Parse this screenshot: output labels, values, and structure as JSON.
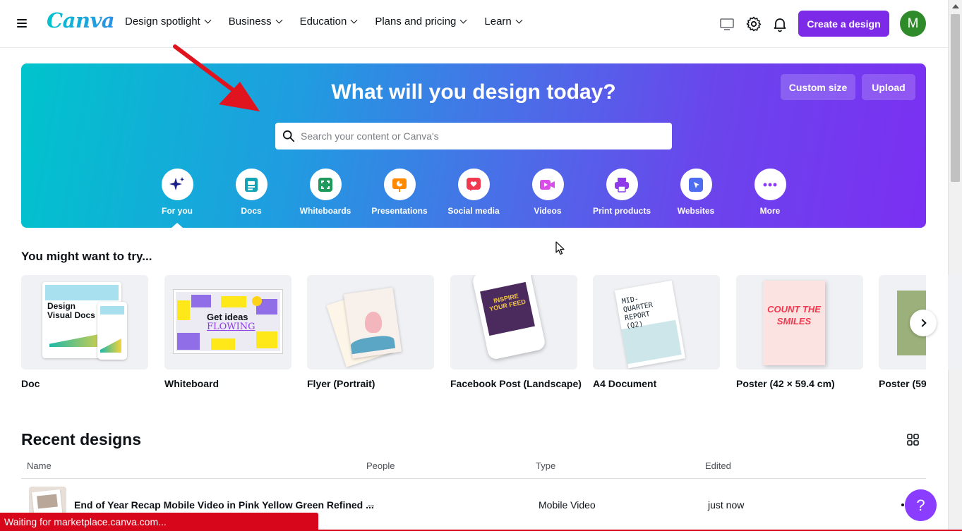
{
  "header": {
    "logo": "Canva",
    "nav": [
      {
        "label": "Design spotlight"
      },
      {
        "label": "Business"
      },
      {
        "label": "Education"
      },
      {
        "label": "Plans and pricing"
      },
      {
        "label": "Learn"
      }
    ],
    "create_label": "Create a design",
    "avatar_initial": "M"
  },
  "hero": {
    "title": "What will you design today?",
    "custom_size_label": "Custom size",
    "upload_label": "Upload",
    "search_placeholder": "Search your content or Canva's",
    "categories": [
      {
        "label": "For you",
        "icon": "sparkle-icon",
        "color": "#1a1d8c"
      },
      {
        "label": "Docs",
        "icon": "doc-icon",
        "color": "#13a3b5"
      },
      {
        "label": "Whiteboards",
        "icon": "whiteboard-icon",
        "color": "#1e9a5c"
      },
      {
        "label": "Presentations",
        "icon": "presentation-icon",
        "color": "#ff8a00"
      },
      {
        "label": "Social media",
        "icon": "heart-icon",
        "color": "#f0384f"
      },
      {
        "label": "Videos",
        "icon": "video-icon",
        "color": "#d84fe8"
      },
      {
        "label": "Print products",
        "icon": "printer-icon",
        "color": "#8f3ae8"
      },
      {
        "label": "Websites",
        "icon": "cursor-icon",
        "color": "#4d6cf0"
      },
      {
        "label": "More",
        "icon": "more-icon",
        "color": "#8b3dff"
      }
    ]
  },
  "try_section": {
    "title": "You might want to try...",
    "tiles": [
      {
        "label": "Doc"
      },
      {
        "label": "Whiteboard"
      },
      {
        "label": "Flyer (Portrait)"
      },
      {
        "label": "Facebook Post (Landscape)"
      },
      {
        "label": "A4 Document"
      },
      {
        "label": "Poster (42 × 59.4 cm)"
      },
      {
        "label": "Poster (59."
      }
    ],
    "doc_thumb_title": "Design Visual Docs",
    "whiteboard_thumb_text1": "Get ideas",
    "whiteboard_thumb_text2": "FLOWING",
    "fb_thumb_text": "INSPIRE YOUR FEED",
    "a4_thumb_text": "MID-QUARTER REPORT (Q2)",
    "poster_thumb_text": "COUNT THE SMILES"
  },
  "recent": {
    "title": "Recent designs",
    "columns": [
      "Name",
      "People",
      "Type",
      "Edited"
    ],
    "rows": [
      {
        "name": "End of Year Recap Mobile Video in Pink Yellow Green Refined ...",
        "people": "--",
        "type": "Mobile Video",
        "edited": "just now"
      }
    ]
  },
  "help_label": "?",
  "status_text": "Waiting for marketplace.canva.com...",
  "colors": {
    "brand_purple": "#7d2ae8",
    "status_red": "#d8061a"
  }
}
